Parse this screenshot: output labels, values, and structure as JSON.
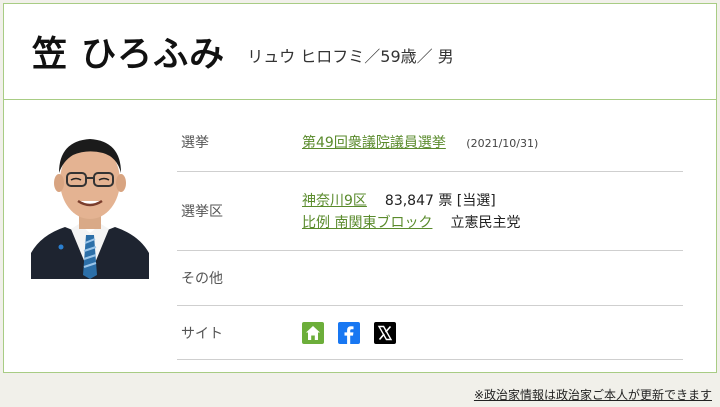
{
  "profile": {
    "name": "笠 ひろふみ",
    "reading_age_gender": "リュウ ヒロフミ／59歳／ 男"
  },
  "details": {
    "election_label": "選挙",
    "election_name": "第49回衆議院議員選挙",
    "election_date": "(2021/10/31)",
    "district_label": "選挙区",
    "district_name": "神奈川9区",
    "district_votes": "83,847 票 [当選]",
    "pr_block": "比例 南関東ブロック",
    "party": "立憲民主党",
    "other_label": "その他",
    "site_label": "サイト"
  },
  "site_icons": [
    "home-icon",
    "facebook-icon",
    "x-icon"
  ],
  "colors": {
    "accent": "#5a8b2c",
    "border": "#a8cc84",
    "home": "#6cae3a",
    "facebook": "#1877f2"
  },
  "footer": {
    "note": "※政治家情報は政治家ご本人が更新できます"
  }
}
